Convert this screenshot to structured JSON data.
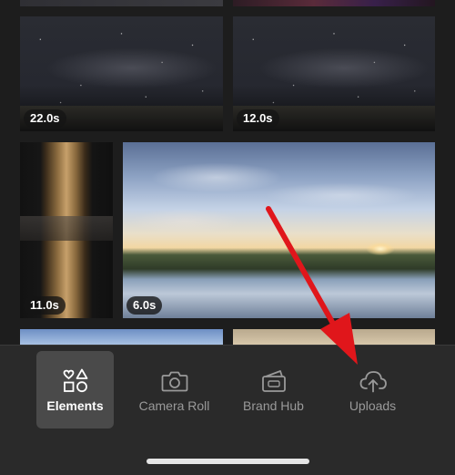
{
  "gallery": {
    "items": [
      {
        "duration": "22.0s"
      },
      {
        "duration": "12.0s"
      },
      {
        "duration": "11.0s"
      },
      {
        "duration": "6.0s"
      }
    ]
  },
  "toolbar": {
    "items": [
      {
        "label": "Elements",
        "icon": "shapes-icon",
        "active": true
      },
      {
        "label": "Camera Roll",
        "icon": "camera-icon",
        "active": false
      },
      {
        "label": "Brand Hub",
        "icon": "brand-hub-icon",
        "active": false
      },
      {
        "label": "Uploads",
        "icon": "upload-cloud-icon",
        "active": false
      }
    ]
  },
  "colors": {
    "background": "#1d1d1d",
    "toolbar": "#2a2a2a",
    "active_tab": "#4a4a4a",
    "annotation_arrow": "#e0161b"
  }
}
